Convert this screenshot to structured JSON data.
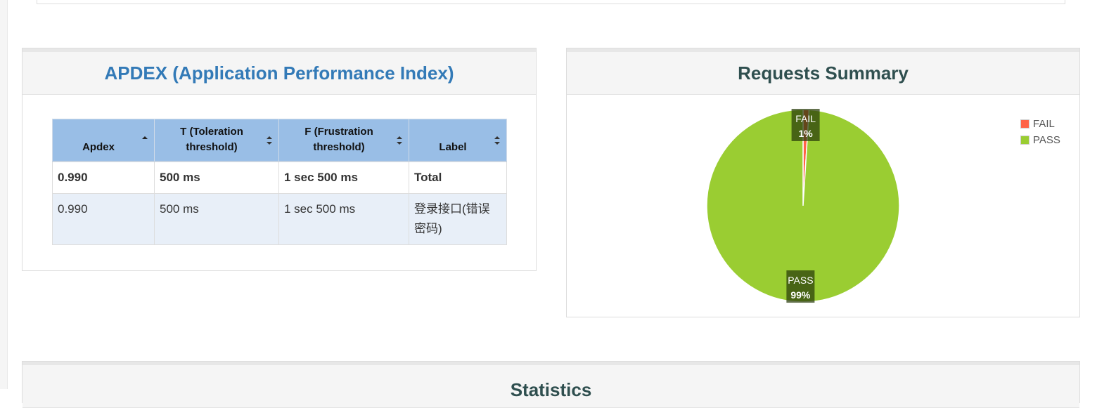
{
  "apdex": {
    "title": "APDEX (Application Performance Index)",
    "headers": [
      "Apdex",
      "T (Toleration threshold)",
      "F (Frustration threshold)",
      "Label"
    ],
    "total": {
      "apdex": "0.990",
      "t": "500 ms",
      "f": "1 sec 500 ms",
      "label": "Total"
    },
    "rows": [
      {
        "apdex": "0.990",
        "t": "500 ms",
        "f": "1 sec 500 ms",
        "label": "登录接口(错误密码)"
      }
    ]
  },
  "summary": {
    "title": "Requests Summary",
    "legend": [
      {
        "name": "FAIL",
        "color": "#ff6347"
      },
      {
        "name": "PASS",
        "color": "#9acd32"
      }
    ]
  },
  "chart_data": {
    "type": "pie",
    "categories": [
      "FAIL",
      "PASS"
    ],
    "values": [
      1,
      99
    ],
    "labels": [
      "1%",
      "99%"
    ],
    "colors": [
      "#ff6347",
      "#9acd32"
    ],
    "legend_position": "top-right"
  },
  "statistics": {
    "title": "Statistics"
  }
}
